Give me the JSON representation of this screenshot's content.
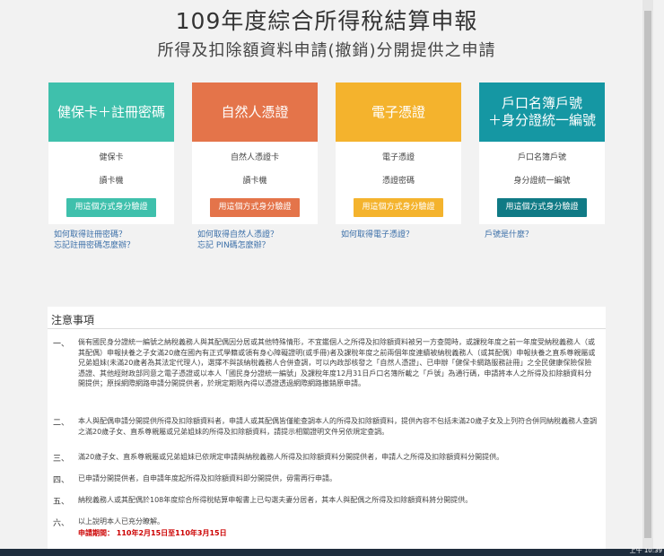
{
  "header": {
    "title": "109年度綜合所得稅結算申報",
    "subtitle": "所得及扣除額資料申請(撤銷)分開提供之申請"
  },
  "cards": [
    {
      "head": "健保卡＋註冊密碼",
      "row1": "健保卡",
      "row2": "讀卡機",
      "button": "用這個方式身分驗證",
      "color": "#3fc0ac",
      "btn_color": "#3fc0ac",
      "links": [
        "如何取得註冊密碼？",
        "忘記註冊密碼怎麼辦？"
      ]
    },
    {
      "head": "自然人憑證",
      "row1": "自然人憑證卡",
      "row2": "讀卡機",
      "button": "用這個方式身分驗證",
      "color": "#e4744a",
      "btn_color": "#e4744a",
      "links": [
        "如何取得自然人憑證？",
        "忘記 PIN碼怎麼辦？"
      ]
    },
    {
      "head": "電子憑證",
      "row1": "電子憑證",
      "row2": "憑證密碼",
      "button": "用這個方式身分驗證",
      "color": "#f4b32d",
      "btn_color": "#f4b32d",
      "links": [
        "如何取得電子憑證？"
      ]
    },
    {
      "head": "戶口名簿戶號＋身分證統一編號",
      "head_line1": "戶口名簿戶號",
      "head_line2": "＋身分證統一編號",
      "row1": "戶口名簿戶號",
      "row2": "身分證統一編號",
      "button": "用這個方式身分驗證",
      "color": "#1597a3",
      "btn_color": "#107a85",
      "links": [
        "戶號是什麼？"
      ]
    }
  ],
  "notes": {
    "title": "注意事項",
    "items": [
      {
        "num": "一、",
        "text": "倘有國民身分證統一編號之納稅義務人與其配偶因分居或其他特殊情形，不宜鑑個人之所得及扣除額資料被另一方查閱時，或課稅年度之前一年度受納稅義務人（或其配偶）申報扶養之子女滿20歲在國內有正式學籍或領有身心障礙證明(或手冊)者及課稅年度之前兩個年度連續被納稅義務人（或其配偶）申報扶養之直系尊親屬或兄弟姐妹(未滿20歲者為其法定代理人)，選擇不與該納稅義務人合併查調，可以內政部核發之「自然人憑證」、已申辦「健保卡網路服務註冊」之全民健康保險保險憑證、其他經財政部同意之電子憑證或以本人「國民身分證統一編號」及課稅年度12月31日戶口名簿所載之「戶號」為通行碼，申請將本人之所得及扣除額資料分開提供；原採網際網路申請分開提供者，於規定期限內得以憑證透過網際網路撤銷原申請。"
      },
      {
        "num": "二、",
        "text": "本人與配偶申請分開提供所得及扣除額資料者，申請人或其配偶皆僅能查調本人的所得及扣除額資料，提供內容不包括未滿20歲子女及上列符合併同納稅義務人查調之滿20歲子女、直系尊親屬或兄弟姐妹的所得及扣除額資料，請提示相關證明文件另依規定查調。"
      },
      {
        "num": "三、",
        "text": "滿20歲子女、直系尊親屬或兄弟姐妹已依規定申請與納稅義務人所得及扣除額資料分開提供者，申請人之所得及扣除額資料分開提供。"
      },
      {
        "num": "四、",
        "text": "已申請分開提供者，自申請年度起所得及扣除額資料即分開提供，毋需再行申請。"
      },
      {
        "num": "五、",
        "text": "納稅義務人或其配偶於108年度綜合所得稅結算申報書上已勾選夫妻分居者，其本人與配偶之所得及扣除額資料將分開提供。"
      },
      {
        "num": "六、",
        "text": "以上說明本人已充分瞭解。",
        "period": "申請期間： 110年2月15日至110年3月15日"
      }
    ]
  },
  "taskbar": {
    "clock": "上午 10:39"
  }
}
